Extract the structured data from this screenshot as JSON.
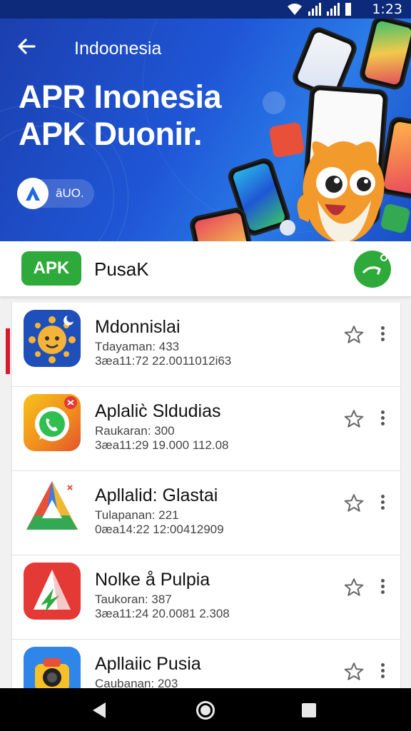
{
  "status_bar": {
    "time": "1:23"
  },
  "header": {
    "country": "Indoonesia",
    "title_line1": "APR Inonesia",
    "title_line2": "APK Duonir.",
    "brand_text": "āUO."
  },
  "search": {
    "badge": "APK",
    "text": "PusaK"
  },
  "apps": [
    {
      "name": "Mdonnislai",
      "meta1": "Tdayaman: 433",
      "meta2": "3æa11:72   22.0011012i63"
    },
    {
      "name": "Aplalic̀ Sldudias",
      "meta1": "Raukaran: 300",
      "meta2": "3æa11:29   19.000 112.08"
    },
    {
      "name": "Apllalid: Glastai",
      "meta1": "Tulapanan: 221",
      "meta2": "0æa14:22   12:00412909"
    },
    {
      "name": "Nolke å Pulpia",
      "meta1": "Taukoran: 387",
      "meta2": "3æa11:24   20.0081 2.308"
    },
    {
      "name": "Apllaiic Pusia",
      "meta1": "Caubanan: 203",
      "meta2": ""
    }
  ],
  "colors": {
    "hero_blue": "#1f56d6",
    "apk_green": "#2eaa3b",
    "accent_red": "#d8192a"
  },
  "icons": [
    "back-arrow-icon",
    "wifi-icon",
    "signal-icon",
    "search-icon",
    "star-icon",
    "more-vert-icon",
    "nav-back-icon",
    "nav-home-icon",
    "nav-recent-icon"
  ]
}
